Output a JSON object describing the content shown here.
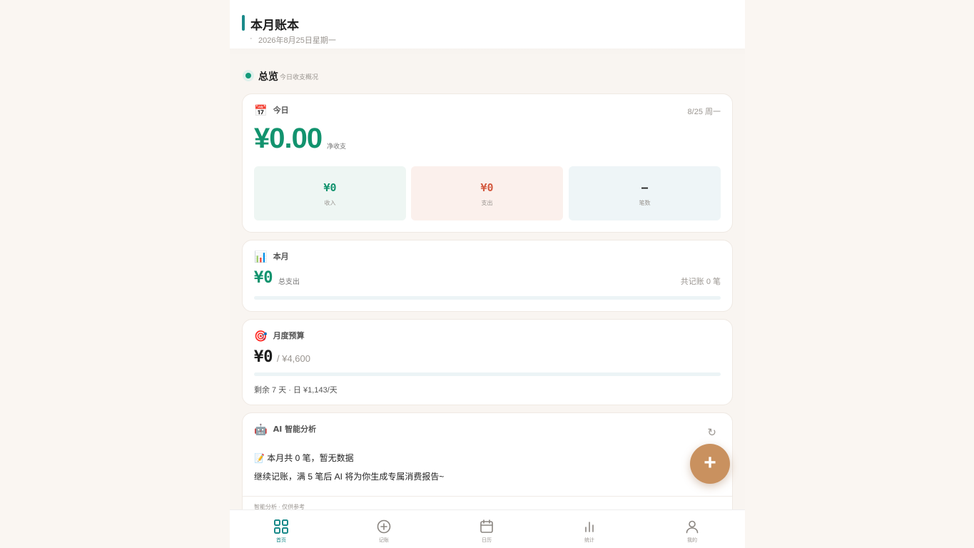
{
  "header": {
    "title": "本月账本",
    "dot": "·",
    "date": "2026年8月25日星期一"
  },
  "section": {
    "title": "总览",
    "subtitle": "今日收支概况"
  },
  "today": {
    "emoji": "📅",
    "title": "今日",
    "date_right": "8/25 周一",
    "amount": "¥0.00",
    "unit": "净收支",
    "tiles": [
      {
        "value": "¥0",
        "label": "收入"
      },
      {
        "value": "¥0",
        "label": "支出"
      },
      {
        "value": "–",
        "label": "笔数"
      }
    ]
  },
  "month": {
    "emoji": "📊",
    "title": "本月",
    "amount": "¥0",
    "unit": "总支出",
    "right": "共记账 0 笔",
    "progress": 0
  },
  "budget": {
    "emoji": "🎯",
    "title": "月度预算",
    "spent": "¥0",
    "total": "/ ¥4,600",
    "note": "剩余 7 天 · 日 ¥1,143/天",
    "progress": 0
  },
  "ai": {
    "emoji": "🤖",
    "title": "AI 智能分析",
    "refresh_icon": "↻",
    "line1": "📝 本月共 0 笔，暂无数据",
    "line2": "继续记账，满 5 笔后 AI 将为你生成专属消费报告~",
    "footer": "智能分析 · 仅供参考"
  },
  "fab": {
    "label": "+"
  },
  "tabbar": {
    "accent": "#1a8a8a",
    "items": [
      {
        "icon": "grid-icon",
        "label": "首页",
        "active": true
      },
      {
        "icon": "plus-circle-icon",
        "label": "记账",
        "active": false
      },
      {
        "icon": "calendar-icon",
        "label": "日历",
        "active": false
      },
      {
        "icon": "bar-chart-icon",
        "label": "统计",
        "active": false
      },
      {
        "icon": "user-icon",
        "label": "我的",
        "active": false
      }
    ]
  }
}
